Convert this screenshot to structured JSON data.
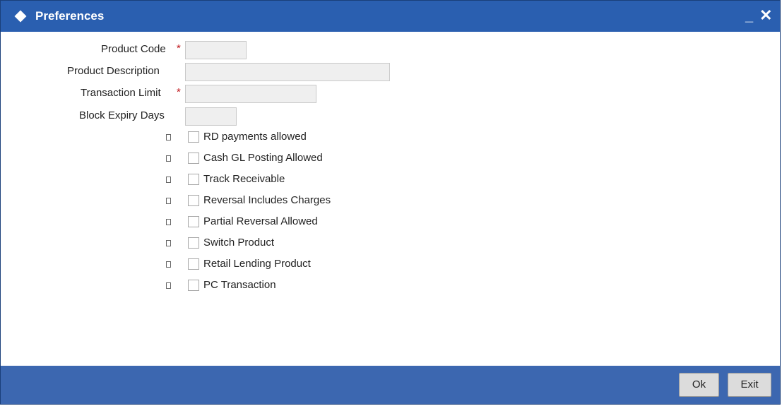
{
  "window": {
    "title": "Preferences",
    "minimize_symbol": "_",
    "close_symbol": "✕"
  },
  "form": {
    "product_code": {
      "label": "Product Code",
      "required_mark": "*",
      "value": ""
    },
    "product_description": {
      "label": "Product Description",
      "value": ""
    },
    "transaction_limit": {
      "label": "Transaction Limit",
      "required_mark": "*",
      "value": ""
    },
    "block_expiry_days": {
      "label": "Block Expiry Days",
      "value": ""
    }
  },
  "options": [
    {
      "label": "RD payments allowed",
      "checked": false
    },
    {
      "label": "Cash GL Posting Allowed",
      "checked": false
    },
    {
      "label": "Track Receivable",
      "checked": false
    },
    {
      "label": "Reversal Includes Charges",
      "checked": false
    },
    {
      "label": "Partial Reversal Allowed",
      "checked": false
    },
    {
      "label": "Switch Product",
      "checked": false
    },
    {
      "label": "Retail Lending Product",
      "checked": false
    },
    {
      "label": "PC Transaction",
      "checked": false
    }
  ],
  "footer": {
    "ok_label": "Ok",
    "exit_label": "Exit"
  },
  "colors": {
    "titlebar": "#2a5fb0",
    "footer": "#3c67b0",
    "required": "#c0161c"
  }
}
